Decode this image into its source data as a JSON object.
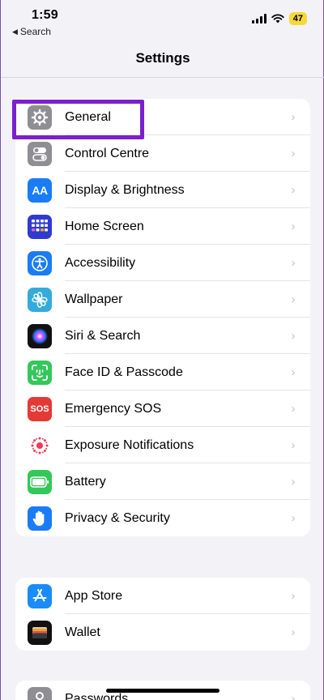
{
  "status": {
    "time": "1:59",
    "back_label": "Search",
    "battery": "47"
  },
  "nav": {
    "title": "Settings"
  },
  "group1": [
    {
      "label": "General",
      "icon": "gear-icon",
      "color": "#8e8e93"
    },
    {
      "label": "Control Centre",
      "icon": "toggles-icon",
      "color": "#8e8e93"
    },
    {
      "label": "Display & Brightness",
      "icon": "text-size-icon",
      "color": "#1a7cf5"
    },
    {
      "label": "Home Screen",
      "icon": "app-grid-icon",
      "color": "#2f3ad0"
    },
    {
      "label": "Accessibility",
      "icon": "accessibility-icon",
      "color": "#1a7cf5"
    },
    {
      "label": "Wallpaper",
      "icon": "flower-icon",
      "color": "#35aadc"
    },
    {
      "label": "Siri & Search",
      "icon": "siri-icon",
      "color": "#111111"
    },
    {
      "label": "Face ID & Passcode",
      "icon": "face-id-icon",
      "color": "#34c759"
    },
    {
      "label": "Emergency SOS",
      "icon": "sos-icon",
      "color": "#e53935"
    },
    {
      "label": "Exposure Notifications",
      "icon": "exposure-icon",
      "color": "#ffffff"
    },
    {
      "label": "Battery",
      "icon": "battery-icon",
      "color": "#34c759"
    },
    {
      "label": "Privacy & Security",
      "icon": "hand-icon",
      "color": "#1a7cf5"
    }
  ],
  "group2": [
    {
      "label": "App Store",
      "icon": "app-store-icon",
      "color": "#1a8cf7"
    },
    {
      "label": "Wallet",
      "icon": "wallet-icon",
      "color": "#111111"
    }
  ],
  "group3": [
    {
      "label": "Passwords",
      "icon": "key-icon",
      "color": "#8e8e93"
    }
  ],
  "highlight_color": "#7b1fd0"
}
